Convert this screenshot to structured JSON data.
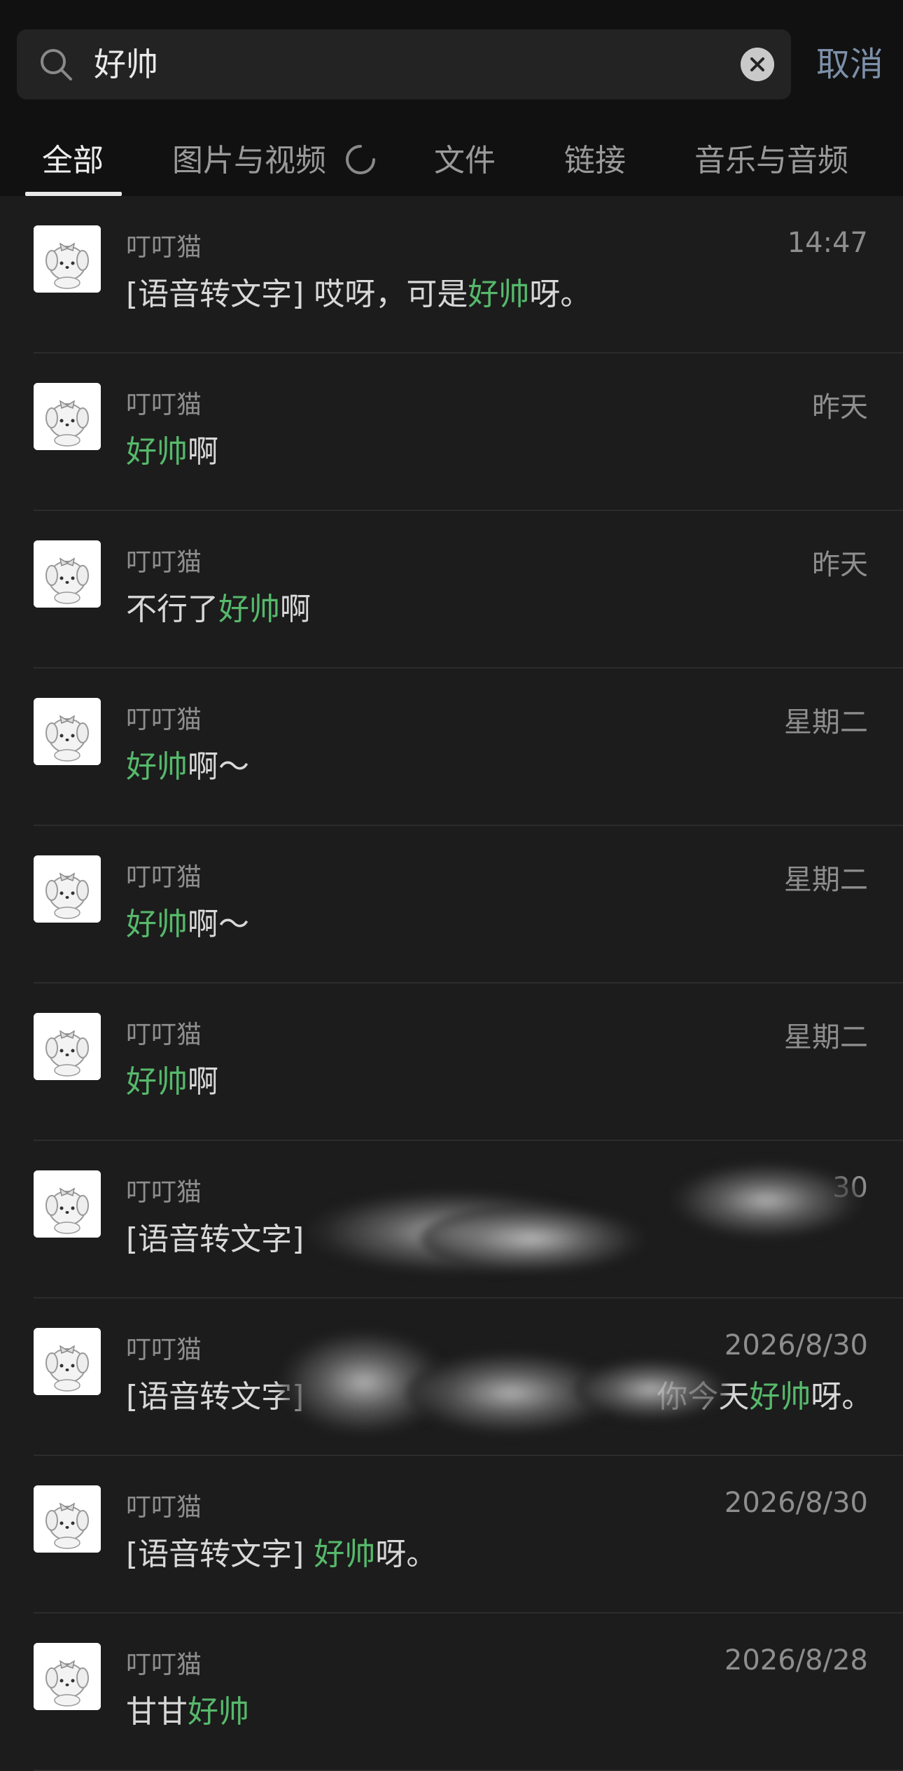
{
  "search": {
    "query": "好帅",
    "cancel_label": "取消"
  },
  "tabs": [
    {
      "label": "全部",
      "active": true
    },
    {
      "label": "图片与视频",
      "active": false,
      "loading": true
    },
    {
      "label": "文件",
      "active": false
    },
    {
      "label": "链接",
      "active": false
    },
    {
      "label": "音乐与音频",
      "active": false
    }
  ],
  "colors": {
    "highlight": "#56b96b",
    "background": "#1c1c1c",
    "cancel": "#7d90a9"
  },
  "results": [
    {
      "sender": "叮叮猫",
      "time": "14:47",
      "pre": "[语音转文字] 哎呀，可是",
      "hl": "好帅",
      "post": "呀。"
    },
    {
      "sender": "叮叮猫",
      "time": "昨天",
      "pre": "",
      "hl": "好帅",
      "post": "啊"
    },
    {
      "sender": "叮叮猫",
      "time": "昨天",
      "pre": "不行了",
      "hl": "好帅",
      "post": "啊"
    },
    {
      "sender": "叮叮猫",
      "time": "星期二",
      "pre": "",
      "hl": "好帅",
      "post": "啊～"
    },
    {
      "sender": "叮叮猫",
      "time": "星期二",
      "pre": "",
      "hl": "好帅",
      "post": "啊～"
    },
    {
      "sender": "叮叮猫",
      "time": "星期二",
      "pre": "",
      "hl": "好帅",
      "post": "啊"
    },
    {
      "sender": "叮叮猫",
      "time": "30",
      "pre": "[语音转文字] ",
      "hl": "",
      "post": ""
    },
    {
      "sender": "叮叮猫",
      "time": "2026/8/30",
      "pre": "[语音转文字] ",
      "hl": "好帅",
      "post": "呀。",
      "mid": "你今天"
    },
    {
      "sender": "叮叮猫",
      "time": "2026/8/30",
      "pre": "[语音转文字] ",
      "hl": "好帅",
      "post": "呀。"
    },
    {
      "sender": "叮叮猫",
      "time": "2026/8/28",
      "pre": "甘甘",
      "hl": "好帅",
      "post": ""
    }
  ]
}
